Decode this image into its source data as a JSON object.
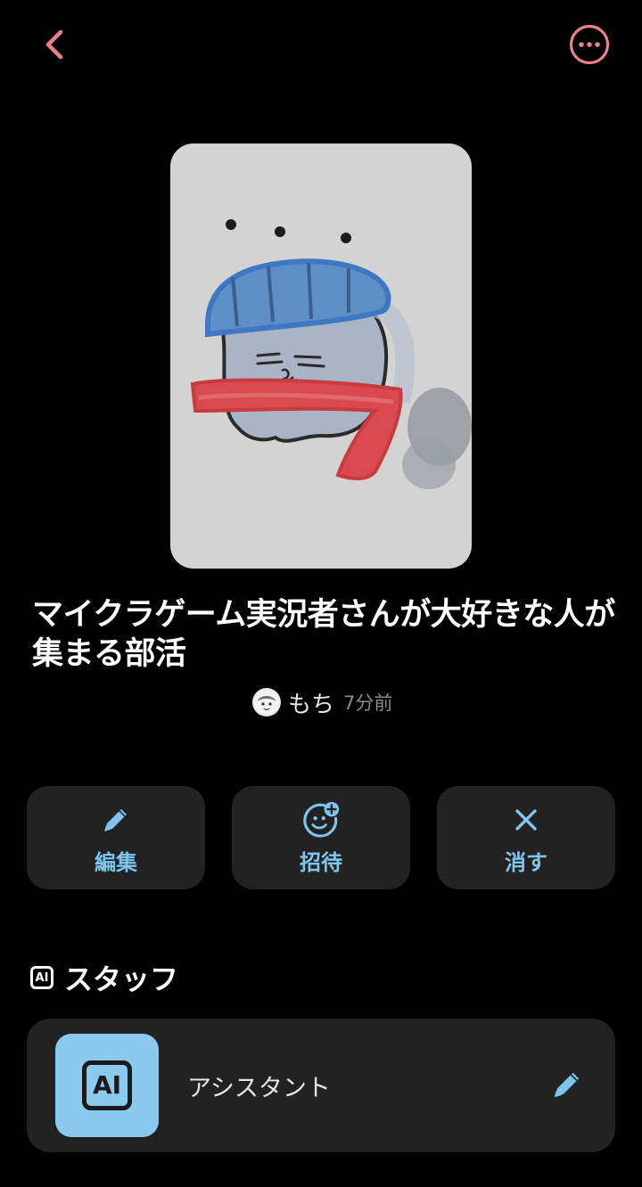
{
  "header": {
    "back_icon": "chevron-left-icon",
    "more_icon": "ellipsis-circle-icon",
    "accent_color": "#e8828a"
  },
  "club": {
    "cover_image": "hand-drawn-character-with-cap-and-red-scarf",
    "title": "マイクラゲーム実況者さんが大好きな人が集まる部活",
    "author_name": "もち",
    "posted_time": "7分前"
  },
  "actions": [
    {
      "icon": "pencil-icon",
      "label": "編集"
    },
    {
      "icon": "face-plus-icon",
      "label": "招待"
    },
    {
      "icon": "close-icon",
      "label": "消す"
    }
  ],
  "staff": {
    "section_icon_text": "AI",
    "section_title": "スタッフ",
    "members": [
      {
        "avatar_text": "AI",
        "name": "アシスタント",
        "edit_icon": "pencil-icon"
      }
    ]
  },
  "colors": {
    "background": "#000000",
    "card": "#222222",
    "action_blue": "#7ec4ee",
    "staff_avatar_bg": "#8cc9ef"
  }
}
